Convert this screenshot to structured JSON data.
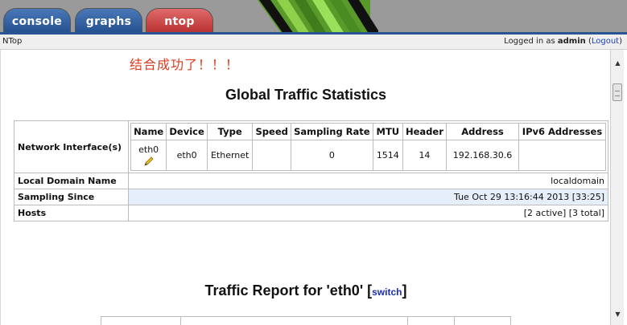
{
  "tabs": {
    "console": "console",
    "graphs": "graphs",
    "ntop": "ntop"
  },
  "status": {
    "title": "NTop",
    "logged_in_prefix": "Logged in as ",
    "user": "admin",
    "logout_open": "(",
    "logout": "Logout",
    "logout_close": ")"
  },
  "notice": "结合成功了！！！",
  "global_title": "Global Traffic Statistics",
  "network": {
    "label": "Network Interface(s)",
    "headers": {
      "name": "Name",
      "device": "Device",
      "type": "Type",
      "speed": "Speed",
      "sampling_rate": "Sampling Rate",
      "mtu": "MTU",
      "header": "Header",
      "address": "Address",
      "ipv6": "IPv6 Addresses"
    },
    "row": {
      "name": "eth0",
      "device": "eth0",
      "type": "Ethernet",
      "speed": "",
      "sampling_rate": "0",
      "mtu": "1514",
      "header": "14",
      "address": "192.168.30.6",
      "ipv6": ""
    },
    "edit_icon": "pencil-icon"
  },
  "rows": {
    "domain_label": "Local Domain Name",
    "domain_value": "localdomain",
    "sampling_label": "Sampling Since",
    "sampling_value": "Tue Oct 29 13:16:44 2013 [33:25]",
    "hosts_label": "Hosts",
    "hosts_value": "[2 active] [3 total]"
  },
  "traffic": {
    "title": "Traffic Report for 'eth0'",
    "bracket_open": "[",
    "switch": "switch",
    "bracket_close": "]"
  },
  "colors": {
    "tab_blue": "#244f8e",
    "tab_red": "#b82f2f",
    "notice_red": "#e03a1c",
    "highlight_row": "#e6eefb"
  }
}
